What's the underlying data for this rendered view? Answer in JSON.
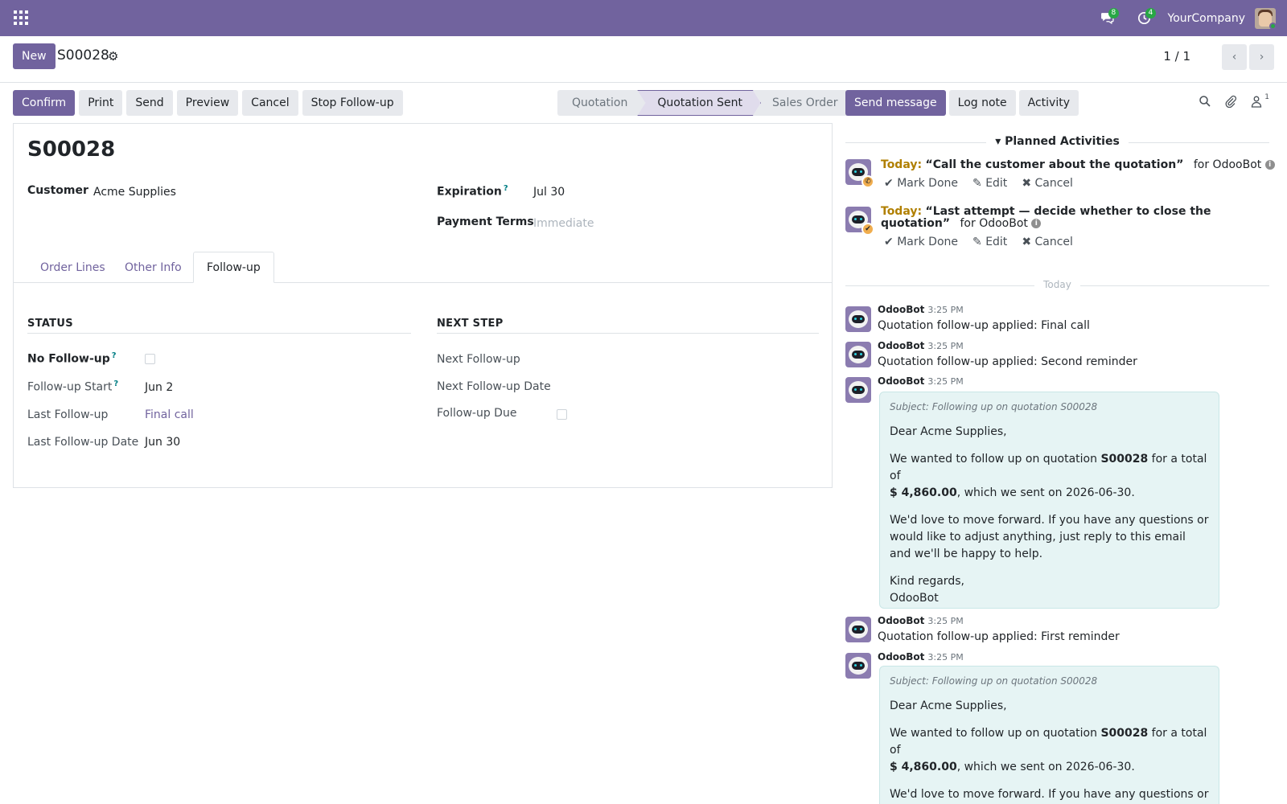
{
  "navbar": {
    "company": "YourCompany",
    "messages_count": "8",
    "activities_count": "4"
  },
  "control": {
    "new_label": "New",
    "record": "S00028",
    "pager": "1 / 1"
  },
  "actions": [
    "Confirm",
    "Print",
    "Send",
    "Preview",
    "Cancel",
    "Stop Follow-up"
  ],
  "statusbar": [
    "Quotation",
    "Quotation Sent",
    "Sales Order"
  ],
  "form": {
    "title": "S00028",
    "customer_label": "Customer",
    "customer": "Acme Supplies",
    "expiration_label": "Expiration",
    "expiration": "Jul 30",
    "payment_terms_label": "Payment Terms",
    "payment_terms_placeholder": "Immediate",
    "help_mark": "?",
    "tabs": [
      "Order Lines",
      "Other Info",
      "Follow-up"
    ],
    "status_head": "STATUS",
    "next_step_head": "NEXT STEP",
    "no_followup_label": "No Follow-up",
    "followup_start_label": "Follow-up Start",
    "followup_start": "Jun 2",
    "last_followup_label": "Last Follow-up",
    "last_followup": "Final call",
    "last_followup_date_label": "Last Follow-up Date",
    "last_followup_date": "Jun 30",
    "next_followup_label": "Next Follow-up",
    "next_followup_date_label": "Next Follow-up Date",
    "followup_due_label": "Follow-up Due"
  },
  "chatter": {
    "send_message": "Send message",
    "log_note": "Log note",
    "activity": "Activity",
    "followers_count": "1",
    "planned_head": "Planned Activities",
    "activities": [
      {
        "today": "Today:",
        "summary": "“Call the customer about the quotation”",
        "for": "for OdooBot"
      },
      {
        "today": "Today:",
        "summary": "“Last attempt — decide whether to close the quotation”",
        "for": "for",
        "for2": "OdooBot"
      }
    ],
    "mark_done": "Mark Done",
    "edit": "Edit",
    "cancel": "Cancel",
    "today_divider": "Today",
    "messages": [
      {
        "author": "OdooBot",
        "time": "3:25 PM",
        "body": "Quotation follow-up applied: Final call"
      },
      {
        "author": "OdooBot",
        "time": "3:25 PM",
        "body": "Quotation follow-up applied: Second reminder"
      },
      {
        "author": "OdooBot",
        "time": "3:25 PM"
      },
      {
        "author": "OdooBot",
        "time": "3:25 PM",
        "body": "Quotation follow-up applied: First reminder"
      },
      {
        "author": "OdooBot",
        "time": "3:25 PM"
      }
    ],
    "mail": {
      "subject": "Subject: Following up on quotation S00028",
      "greeting": "Dear Acme Supplies,",
      "p1_a": "We wanted to follow up on quotation ",
      "p1_ref": "S00028",
      "p1_b": " for a total of",
      "p1_amount": "$ 4,860.00",
      "p1_c": ", which we sent on 2026-06-30.",
      "p2": "We'd love to move forward. If you have any questions or would like to adjust anything, just reply to this email and we'll be happy to help.",
      "p2_cut": "We'd love to move forward. If you have any questions or would like to adjust anything, just reply to this email and we'll be",
      "regards": "Kind regards,",
      "sign": "OdooBot"
    }
  }
}
